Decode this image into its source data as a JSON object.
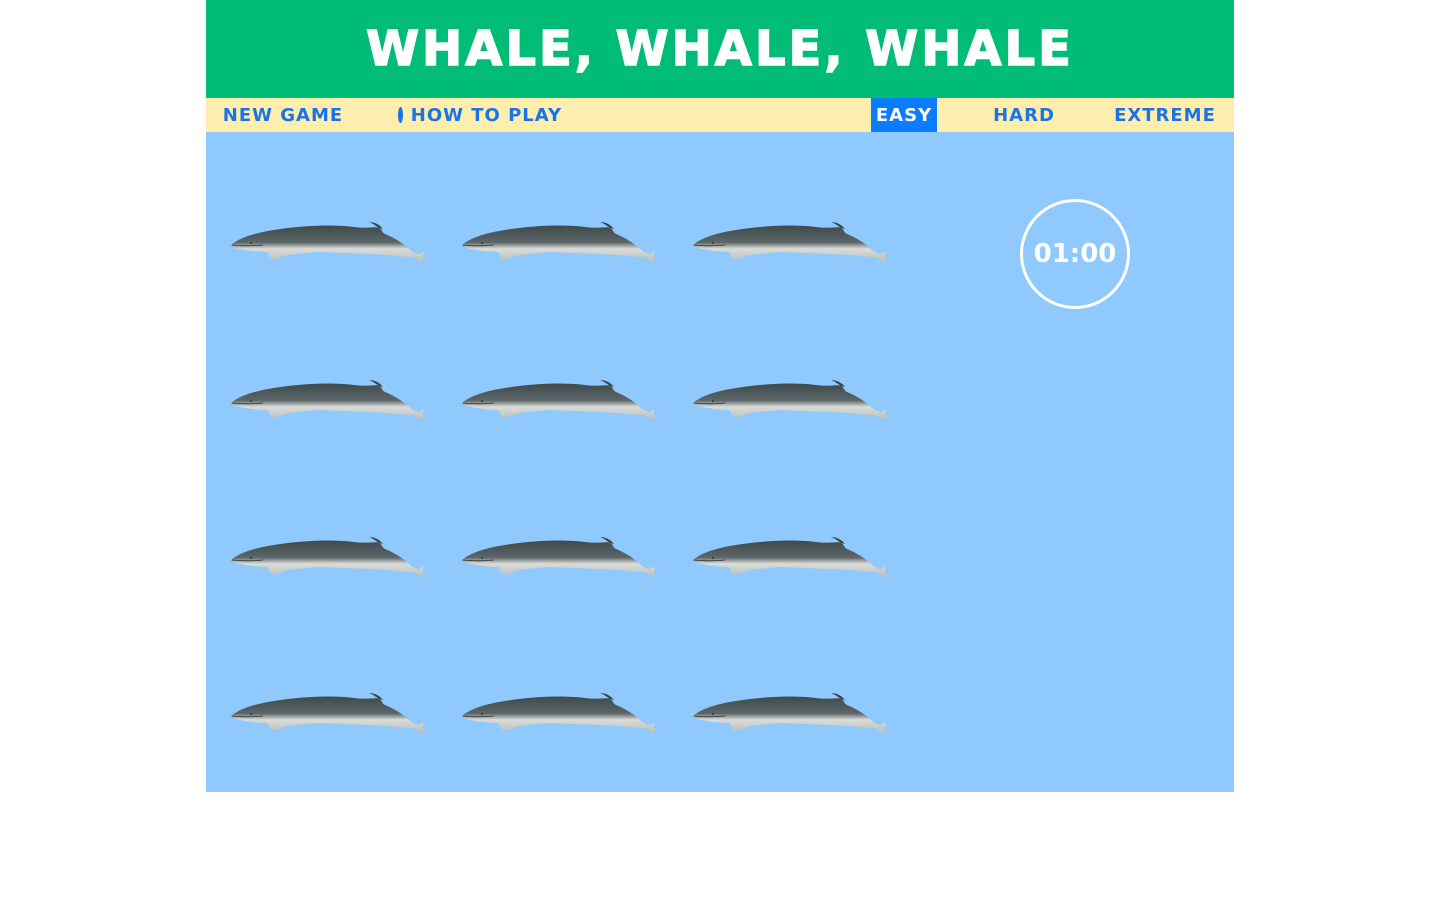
{
  "header": {
    "title": "Whale, Whale, Whale"
  },
  "nav": {
    "new_game": "NEW GAME",
    "how_to_play": "HOW TO PLAY",
    "difficulty": [
      {
        "label": "EASY",
        "selected": true
      },
      {
        "label": "HARD",
        "selected": false
      },
      {
        "label": "EXTREME",
        "selected": false
      }
    ]
  },
  "board": {
    "rows": 4,
    "cols": 3,
    "whale_icon": "fin-whale",
    "timer": "01:00"
  },
  "colors": {
    "header_bg": "#00bc76",
    "nav_bg": "#fdeeae",
    "nav_text": "#1a73e8",
    "active_bg": "#0a7cff",
    "board_bg": "#8fc9fd"
  }
}
